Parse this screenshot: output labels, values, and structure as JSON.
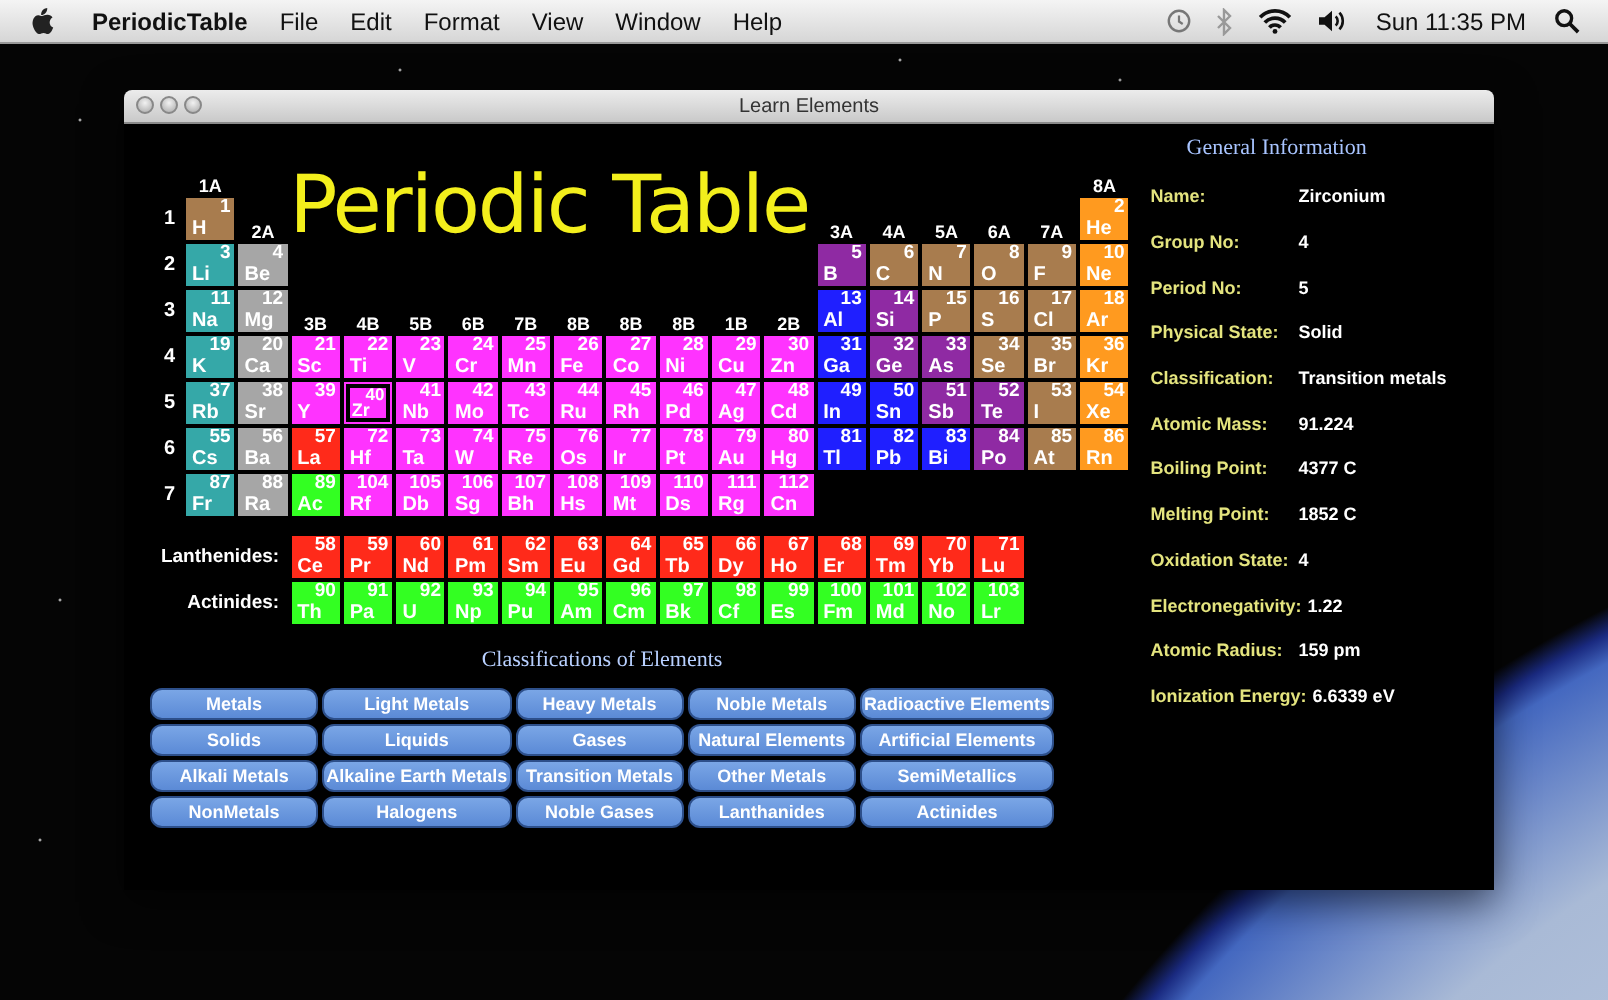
{
  "menu_bar": {
    "app_name": "PeriodicTable",
    "menus": [
      "File",
      "Edit",
      "Format",
      "View",
      "Window",
      "Help"
    ],
    "clock": "Sun 11:35 PM"
  },
  "window": {
    "title": "Learn Elements"
  },
  "periodic_table": {
    "title": "Periodic Table",
    "rows": [
      {
        "left": [
          {
            "kind": "group",
            "text": "1A"
          }
        ],
        "right": [
          {
            "kind": "group",
            "text": "8A"
          }
        ]
      },
      {
        "label": "1",
        "left": [
          {
            "kind": "element",
            "number": "1",
            "symbol": "H",
            "color": "#a87c4e",
            "selected": false
          },
          {
            "kind": "group",
            "text": "2A"
          }
        ],
        "right": [
          {
            "kind": "group",
            "text": "3A"
          },
          {
            "kind": "group",
            "text": "4A"
          },
          {
            "kind": "group",
            "text": "5A"
          },
          {
            "kind": "group",
            "text": "6A"
          },
          {
            "kind": "group",
            "text": "7A"
          },
          {
            "kind": "element",
            "number": "2",
            "symbol": "He",
            "color": "#ff9a1f",
            "selected": false
          }
        ]
      },
      {
        "label": "2",
        "left": [
          {
            "kind": "element",
            "number": "3",
            "symbol": "Li",
            "color": "#35a8a8",
            "selected": false
          },
          {
            "kind": "element",
            "number": "4",
            "symbol": "Be",
            "color": "#a6a6a6",
            "selected": false
          }
        ],
        "right": [
          {
            "kind": "element",
            "number": "5",
            "symbol": "B",
            "color": "#8f2aa3",
            "selected": false
          },
          {
            "kind": "element",
            "number": "6",
            "symbol": "C",
            "color": "#a87c4e",
            "selected": false
          },
          {
            "kind": "element",
            "number": "7",
            "symbol": "N",
            "color": "#a87c4e",
            "selected": false
          },
          {
            "kind": "element",
            "number": "8",
            "symbol": "O",
            "color": "#a87c4e",
            "selected": false
          },
          {
            "kind": "element",
            "number": "9",
            "symbol": "F",
            "color": "#a87c4e",
            "selected": false
          },
          {
            "kind": "element",
            "number": "10",
            "symbol": "Ne",
            "color": "#ff9a1f",
            "selected": false
          }
        ]
      },
      {
        "label": "3",
        "left": [
          {
            "kind": "element",
            "number": "11",
            "symbol": "Na",
            "color": "#35a8a8",
            "selected": false
          },
          {
            "kind": "element",
            "number": "12",
            "symbol": "Mg",
            "color": "#a6a6a6",
            "selected": false
          },
          {
            "kind": "group",
            "text": "3B"
          },
          {
            "kind": "group",
            "text": "4B"
          },
          {
            "kind": "group",
            "text": "5B"
          },
          {
            "kind": "group",
            "text": "6B"
          },
          {
            "kind": "group",
            "text": "7B"
          },
          {
            "kind": "group",
            "text": "8B"
          },
          {
            "kind": "group",
            "text": "8B"
          },
          {
            "kind": "group",
            "text": "8B"
          },
          {
            "kind": "group",
            "text": "1B"
          },
          {
            "kind": "group",
            "text": "2B"
          }
        ],
        "right": [
          {
            "kind": "element",
            "number": "13",
            "symbol": "Al",
            "color": "#1f1fff",
            "selected": false
          },
          {
            "kind": "element",
            "number": "14",
            "symbol": "Si",
            "color": "#8f2aa3",
            "selected": false
          },
          {
            "kind": "element",
            "number": "15",
            "symbol": "P",
            "color": "#a87c4e",
            "selected": false
          },
          {
            "kind": "element",
            "number": "16",
            "symbol": "S",
            "color": "#a87c4e",
            "selected": false
          },
          {
            "kind": "element",
            "number": "17",
            "symbol": "Cl",
            "color": "#a87c4e",
            "selected": false
          },
          {
            "kind": "element",
            "number": "18",
            "symbol": "Ar",
            "color": "#ff9a1f",
            "selected": false
          }
        ]
      },
      {
        "label": "4",
        "left": [
          {
            "kind": "element",
            "number": "19",
            "symbol": "K",
            "color": "#35a8a8",
            "selected": false
          },
          {
            "kind": "element",
            "number": "20",
            "symbol": "Ca",
            "color": "#a6a6a6",
            "selected": false
          },
          {
            "kind": "element",
            "number": "21",
            "symbol": "Sc",
            "color": "#ff33ff",
            "selected": false
          },
          {
            "kind": "element",
            "number": "22",
            "symbol": "Ti",
            "color": "#ff33ff",
            "selected": false
          },
          {
            "kind": "element",
            "number": "23",
            "symbol": "V",
            "color": "#ff33ff",
            "selected": false
          },
          {
            "kind": "element",
            "number": "24",
            "symbol": "Cr",
            "color": "#ff33ff",
            "selected": false
          },
          {
            "kind": "element",
            "number": "25",
            "symbol": "Mn",
            "color": "#ff33ff",
            "selected": false
          },
          {
            "kind": "element",
            "number": "26",
            "symbol": "Fe",
            "color": "#ff33ff",
            "selected": false
          },
          {
            "kind": "element",
            "number": "27",
            "symbol": "Co",
            "color": "#ff33ff",
            "selected": false
          },
          {
            "kind": "element",
            "number": "28",
            "symbol": "Ni",
            "color": "#ff33ff",
            "selected": false
          },
          {
            "kind": "element",
            "number": "29",
            "symbol": "Cu",
            "color": "#ff33ff",
            "selected": false
          },
          {
            "kind": "element",
            "number": "30",
            "symbol": "Zn",
            "color": "#ff33ff",
            "selected": false
          },
          {
            "kind": "element",
            "number": "31",
            "symbol": "Ga",
            "color": "#1f1fff",
            "selected": false
          },
          {
            "kind": "element",
            "number": "32",
            "symbol": "Ge",
            "color": "#8f2aa3",
            "selected": false
          },
          {
            "kind": "element",
            "number": "33",
            "symbol": "As",
            "color": "#8f2aa3",
            "selected": false
          },
          {
            "kind": "element",
            "number": "34",
            "symbol": "Se",
            "color": "#a87c4e",
            "selected": false
          },
          {
            "kind": "element",
            "number": "35",
            "symbol": "Br",
            "color": "#a87c4e",
            "selected": false
          },
          {
            "kind": "element",
            "number": "36",
            "symbol": "Kr",
            "color": "#ff9a1f",
            "selected": false
          }
        ],
        "right": []
      },
      {
        "label": "5",
        "left": [
          {
            "kind": "element",
            "number": "37",
            "symbol": "Rb",
            "color": "#35a8a8",
            "selected": false
          },
          {
            "kind": "element",
            "number": "38",
            "symbol": "Sr",
            "color": "#a6a6a6",
            "selected": false
          },
          {
            "kind": "element",
            "number": "39",
            "symbol": "Y",
            "color": "#ff33ff",
            "selected": false
          },
          {
            "kind": "element",
            "number": "40",
            "symbol": "Zr",
            "color": "#ff33ff",
            "selected": true
          },
          {
            "kind": "element",
            "number": "41",
            "symbol": "Nb",
            "color": "#ff33ff",
            "selected": false
          },
          {
            "kind": "element",
            "number": "42",
            "symbol": "Mo",
            "color": "#ff33ff",
            "selected": false
          },
          {
            "kind": "element",
            "number": "43",
            "symbol": "Tc",
            "color": "#ff33ff",
            "selected": false
          },
          {
            "kind": "element",
            "number": "44",
            "symbol": "Ru",
            "color": "#ff33ff",
            "selected": false
          },
          {
            "kind": "element",
            "number": "45",
            "symbol": "Rh",
            "color": "#ff33ff",
            "selected": false
          },
          {
            "kind": "element",
            "number": "46",
            "symbol": "Pd",
            "color": "#ff33ff",
            "selected": false
          },
          {
            "kind": "element",
            "number": "47",
            "symbol": "Ag",
            "color": "#ff33ff",
            "selected": false
          },
          {
            "kind": "element",
            "number": "48",
            "symbol": "Cd",
            "color": "#ff33ff",
            "selected": false
          },
          {
            "kind": "element",
            "number": "49",
            "symbol": "In",
            "color": "#1f1fff",
            "selected": false
          },
          {
            "kind": "element",
            "number": "50",
            "symbol": "Sn",
            "color": "#1f1fff",
            "selected": false
          },
          {
            "kind": "element",
            "number": "51",
            "symbol": "Sb",
            "color": "#8f2aa3",
            "selected": false
          },
          {
            "kind": "element",
            "number": "52",
            "symbol": "Te",
            "color": "#8f2aa3",
            "selected": false
          },
          {
            "kind": "element",
            "number": "53",
            "symbol": "I",
            "color": "#a87c4e",
            "selected": false
          },
          {
            "kind": "element",
            "number": "54",
            "symbol": "Xe",
            "color": "#ff9a1f",
            "selected": false
          }
        ],
        "right": []
      },
      {
        "label": "6",
        "left": [
          {
            "kind": "element",
            "number": "55",
            "symbol": "Cs",
            "color": "#35a8a8",
            "selected": false
          },
          {
            "kind": "element",
            "number": "56",
            "symbol": "Ba",
            "color": "#a6a6a6",
            "selected": false
          },
          {
            "kind": "element",
            "number": "57",
            "symbol": "La",
            "color": "#ff2a1a",
            "selected": false
          },
          {
            "kind": "element",
            "number": "72",
            "symbol": "Hf",
            "color": "#ff33ff",
            "selected": false
          },
          {
            "kind": "element",
            "number": "73",
            "symbol": "Ta",
            "color": "#ff33ff",
            "selected": false
          },
          {
            "kind": "element",
            "number": "74",
            "symbol": "W",
            "color": "#ff33ff",
            "selected": false
          },
          {
            "kind": "element",
            "number": "75",
            "symbol": "Re",
            "color": "#ff33ff",
            "selected": false
          },
          {
            "kind": "element",
            "number": "76",
            "symbol": "Os",
            "color": "#ff33ff",
            "selected": false
          },
          {
            "kind": "element",
            "number": "77",
            "symbol": "Ir",
            "color": "#ff33ff",
            "selected": false
          },
          {
            "kind": "element",
            "number": "78",
            "symbol": "Pt",
            "color": "#ff33ff",
            "selected": false
          },
          {
            "kind": "element",
            "number": "79",
            "symbol": "Au",
            "color": "#ff33ff",
            "selected": false
          },
          {
            "kind": "element",
            "number": "80",
            "symbol": "Hg",
            "color": "#ff33ff",
            "selected": false
          },
          {
            "kind": "element",
            "number": "81",
            "symbol": "Tl",
            "color": "#1f1fff",
            "selected": false
          },
          {
            "kind": "element",
            "number": "82",
            "symbol": "Pb",
            "color": "#1f1fff",
            "selected": false
          },
          {
            "kind": "element",
            "number": "83",
            "symbol": "Bi",
            "color": "#1f1fff",
            "selected": false
          },
          {
            "kind": "element",
            "number": "84",
            "symbol": "Po",
            "color": "#8f2aa3",
            "selected": false
          },
          {
            "kind": "element",
            "number": "85",
            "symbol": "At",
            "color": "#a87c4e",
            "selected": false
          },
          {
            "kind": "element",
            "number": "86",
            "symbol": "Rn",
            "color": "#ff9a1f",
            "selected": false
          }
        ],
        "right": []
      },
      {
        "label": "7",
        "left": [
          {
            "kind": "element",
            "number": "87",
            "symbol": "Fr",
            "color": "#35a8a8",
            "selected": false
          },
          {
            "kind": "element",
            "number": "88",
            "symbol": "Ra",
            "color": "#a6a6a6",
            "selected": false
          },
          {
            "kind": "element",
            "number": "89",
            "symbol": "Ac",
            "color": "#33ff22",
            "selected": false
          },
          {
            "kind": "element",
            "number": "104",
            "symbol": "Rf",
            "color": "#ff33ff",
            "selected": false
          },
          {
            "kind": "element",
            "number": "105",
            "symbol": "Db",
            "color": "#ff33ff",
            "selected": false
          },
          {
            "kind": "element",
            "number": "106",
            "symbol": "Sg",
            "color": "#ff33ff",
            "selected": false
          },
          {
            "kind": "element",
            "number": "107",
            "symbol": "Bh",
            "color": "#ff33ff",
            "selected": false
          },
          {
            "kind": "element",
            "number": "108",
            "symbol": "Hs",
            "color": "#ff33ff",
            "selected": false
          },
          {
            "kind": "element",
            "number": "109",
            "symbol": "Mt",
            "color": "#ff33ff",
            "selected": false
          },
          {
            "kind": "element",
            "number": "110",
            "symbol": "Ds",
            "color": "#ff33ff",
            "selected": false
          },
          {
            "kind": "element",
            "number": "111",
            "symbol": "Rg",
            "color": "#ff33ff",
            "selected": false
          },
          {
            "kind": "element",
            "number": "112",
            "symbol": "Cn",
            "color": "#ff33ff",
            "selected": false
          }
        ],
        "right": []
      }
    ],
    "series": [
      {
        "label": "Lanthenides:",
        "elements": [
          {
            "number": "58",
            "symbol": "Ce",
            "color": "#ff2a1a",
            "selected": false
          },
          {
            "number": "59",
            "symbol": "Pr",
            "color": "#ff2a1a",
            "selected": false
          },
          {
            "number": "60",
            "symbol": "Nd",
            "color": "#ff2a1a",
            "selected": false
          },
          {
            "number": "61",
            "symbol": "Pm",
            "color": "#ff2a1a",
            "selected": false
          },
          {
            "number": "62",
            "symbol": "Sm",
            "color": "#ff2a1a",
            "selected": false
          },
          {
            "number": "63",
            "symbol": "Eu",
            "color": "#ff2a1a",
            "selected": false
          },
          {
            "number": "64",
            "symbol": "Gd",
            "color": "#ff2a1a",
            "selected": false
          },
          {
            "number": "65",
            "symbol": "Tb",
            "color": "#ff2a1a",
            "selected": false
          },
          {
            "number": "66",
            "symbol": "Dy",
            "color": "#ff2a1a",
            "selected": false
          },
          {
            "number": "67",
            "symbol": "Ho",
            "color": "#ff2a1a",
            "selected": false
          },
          {
            "number": "68",
            "symbol": "Er",
            "color": "#ff2a1a",
            "selected": false
          },
          {
            "number": "69",
            "symbol": "Tm",
            "color": "#ff2a1a",
            "selected": false
          },
          {
            "number": "70",
            "symbol": "Yb",
            "color": "#ff2a1a",
            "selected": false
          },
          {
            "number": "71",
            "symbol": "Lu",
            "color": "#ff2a1a",
            "selected": false
          }
        ]
      },
      {
        "label": "Actinides:",
        "elements": [
          {
            "number": "90",
            "symbol": "Th",
            "color": "#33ff22",
            "selected": false
          },
          {
            "number": "91",
            "symbol": "Pa",
            "color": "#33ff22",
            "selected": false
          },
          {
            "number": "92",
            "symbol": "U",
            "color": "#33ff22",
            "selected": false
          },
          {
            "number": "93",
            "symbol": "Np",
            "color": "#33ff22",
            "selected": false
          },
          {
            "number": "94",
            "symbol": "Pu",
            "color": "#33ff22",
            "selected": false
          },
          {
            "number": "95",
            "symbol": "Am",
            "color": "#33ff22",
            "selected": false
          },
          {
            "number": "96",
            "symbol": "Cm",
            "color": "#33ff22",
            "selected": false
          },
          {
            "number": "97",
            "symbol": "Bk",
            "color": "#33ff22",
            "selected": false
          },
          {
            "number": "98",
            "symbol": "Cf",
            "color": "#33ff22",
            "selected": false
          },
          {
            "number": "99",
            "symbol": "Es",
            "color": "#33ff22",
            "selected": false
          },
          {
            "number": "100",
            "symbol": "Fm",
            "color": "#33ff22",
            "selected": false
          },
          {
            "number": "101",
            "symbol": "Md",
            "color": "#33ff22",
            "selected": false
          },
          {
            "number": "102",
            "symbol": "No",
            "color": "#33ff22",
            "selected": false
          },
          {
            "number": "103",
            "symbol": "Lr",
            "color": "#33ff22",
            "selected": false
          }
        ]
      }
    ]
  },
  "classifications": {
    "title": "Classifications of Elements",
    "buttons": [
      "Metals",
      "Light Metals",
      "Heavy Metals",
      "Noble Metals",
      "Radioactive Elements",
      "Solids",
      "Liquids",
      "Gases",
      "Natural Elements",
      "Artificial Elements",
      "Alkali Metals",
      "Alkaline Earth Metals",
      "Transition Metals",
      "Other Metals",
      "SemiMetallics",
      "NonMetals",
      "Halogens",
      "Noble Gases",
      "Lanthanides",
      "Actinides"
    ]
  },
  "general_information": {
    "title": "General Information",
    "fields": [
      {
        "label": "Name:",
        "value": "Zirconium"
      },
      {
        "label": "Group No:",
        "value": "4"
      },
      {
        "label": "Period No:",
        "value": "5"
      },
      {
        "label": "Physical State:",
        "value": "Solid"
      },
      {
        "label": "Classification:",
        "value": "Transition metals"
      },
      {
        "label": "Atomic Mass:",
        "value": "91.224"
      },
      {
        "label": "Boiling Point:",
        "value": "4377 C"
      },
      {
        "label": "Melting Point:",
        "value": "1852 C"
      },
      {
        "label": "Oxidation State:",
        "value": "4"
      },
      {
        "label": "Electronegativity:",
        "value": "1.22"
      },
      {
        "label": "Atomic Radius:",
        "value": "159 pm"
      },
      {
        "label": "Ionization Energy:",
        "value": "6.6339 eV"
      }
    ]
  }
}
